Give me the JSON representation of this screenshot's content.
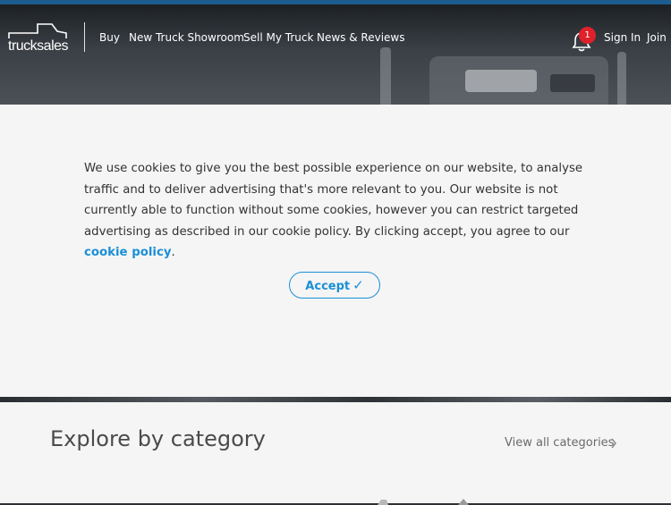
{
  "header": {
    "logo_text": "trucksales",
    "nav": [
      {
        "label": "Buy"
      },
      {
        "label": "New Truck Showroom"
      },
      {
        "label": "Sell My Truck"
      },
      {
        "label": "News & Reviews"
      }
    ],
    "notifications_count": "1",
    "sign_in_label": "Sign In",
    "join_label": "Join"
  },
  "cookie_banner": {
    "text": "We use cookies to give you the best possible experience on our website, to analyse traffic and to deliver advertising that's more relevant to you. Our website is not currently able to function without some cookies, however you can restrict targeted advertising as described in our cookie policy. By clicking accept, you agree to our ",
    "link_label": "cookie policy",
    "text_end": ".",
    "accept_label": "Accept",
    "accept_icon": "✓"
  },
  "explore": {
    "title": "Explore by category",
    "view_all_label": "View all categories"
  },
  "colors": {
    "accent": "#1b8fd6",
    "badge": "#e0202a",
    "top_strip": "#1d5c8f"
  }
}
